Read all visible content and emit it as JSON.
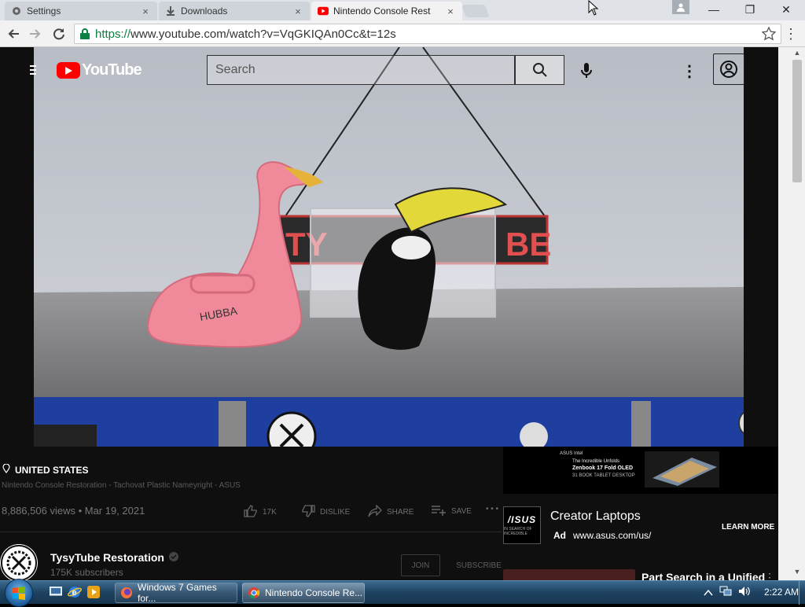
{
  "browser": {
    "tabs": [
      {
        "title": "Settings",
        "icon": "gear-icon",
        "active": false
      },
      {
        "title": "Downloads",
        "icon": "download-icon",
        "active": false
      },
      {
        "title": "Nintendo Console Rest",
        "icon": "youtube-icon",
        "active": true
      }
    ],
    "close_glyph": "×",
    "window_controls": {
      "minimize": "—",
      "maximize": "❐",
      "close": "✕"
    },
    "url_scheme": "https://",
    "url_rest": "www.youtube.com/watch?v=VqGKIQAn0Cc&t=12s",
    "menu_glyph": "⋮"
  },
  "youtube": {
    "logo_text": "YouTube",
    "search_placeholder": "Search",
    "more_glyph": "⋮",
    "location": "UNITED STATES",
    "video_subtitle": "Nintendo Console Restoration - Tachovat Plastic Nameyright - ASUS",
    "views_date": "8,886,506 views • Mar 19, 2021",
    "actions": {
      "like": "17K",
      "dislike": "DISLIKE",
      "share": "SHARE",
      "save": "SAVE",
      "more": "• • •"
    },
    "channel": {
      "name": "TysyTube Restoration",
      "subscribers": "175K subscribers",
      "join_label": "JOIN",
      "subscribe_label": "SUBSCRIBE"
    },
    "ad": {
      "banner_brand": "ASUS Intel",
      "banner_headline": "The Incredible Unfolds",
      "banner_sub": "Zenbook 17 Fold OLED",
      "banner_spec": "31   BOOK  TABLET  DESKTOP",
      "logo_text": "/ISUS",
      "logo_tag": "IN SEARCH OF INCREDIBLE",
      "title": "Creator Laptops",
      "badge": "Ad",
      "url": "www.asus.com/us/",
      "learn_more": "LEARN MORE"
    },
    "next_video_title": "Part Search in a Unified",
    "next_more": "⋮"
  },
  "taskbar": {
    "tasks": [
      {
        "label": "Windows 7 Games for...",
        "icon": "firefox-icon"
      },
      {
        "label": "Nintendo Console Re...",
        "icon": "chrome-icon"
      }
    ],
    "clock": "2:22 AM"
  },
  "colors": {
    "youtube_red": "#ff0000",
    "omnibox_https": "#0b8043",
    "page_bg": "#0f0f0f"
  }
}
